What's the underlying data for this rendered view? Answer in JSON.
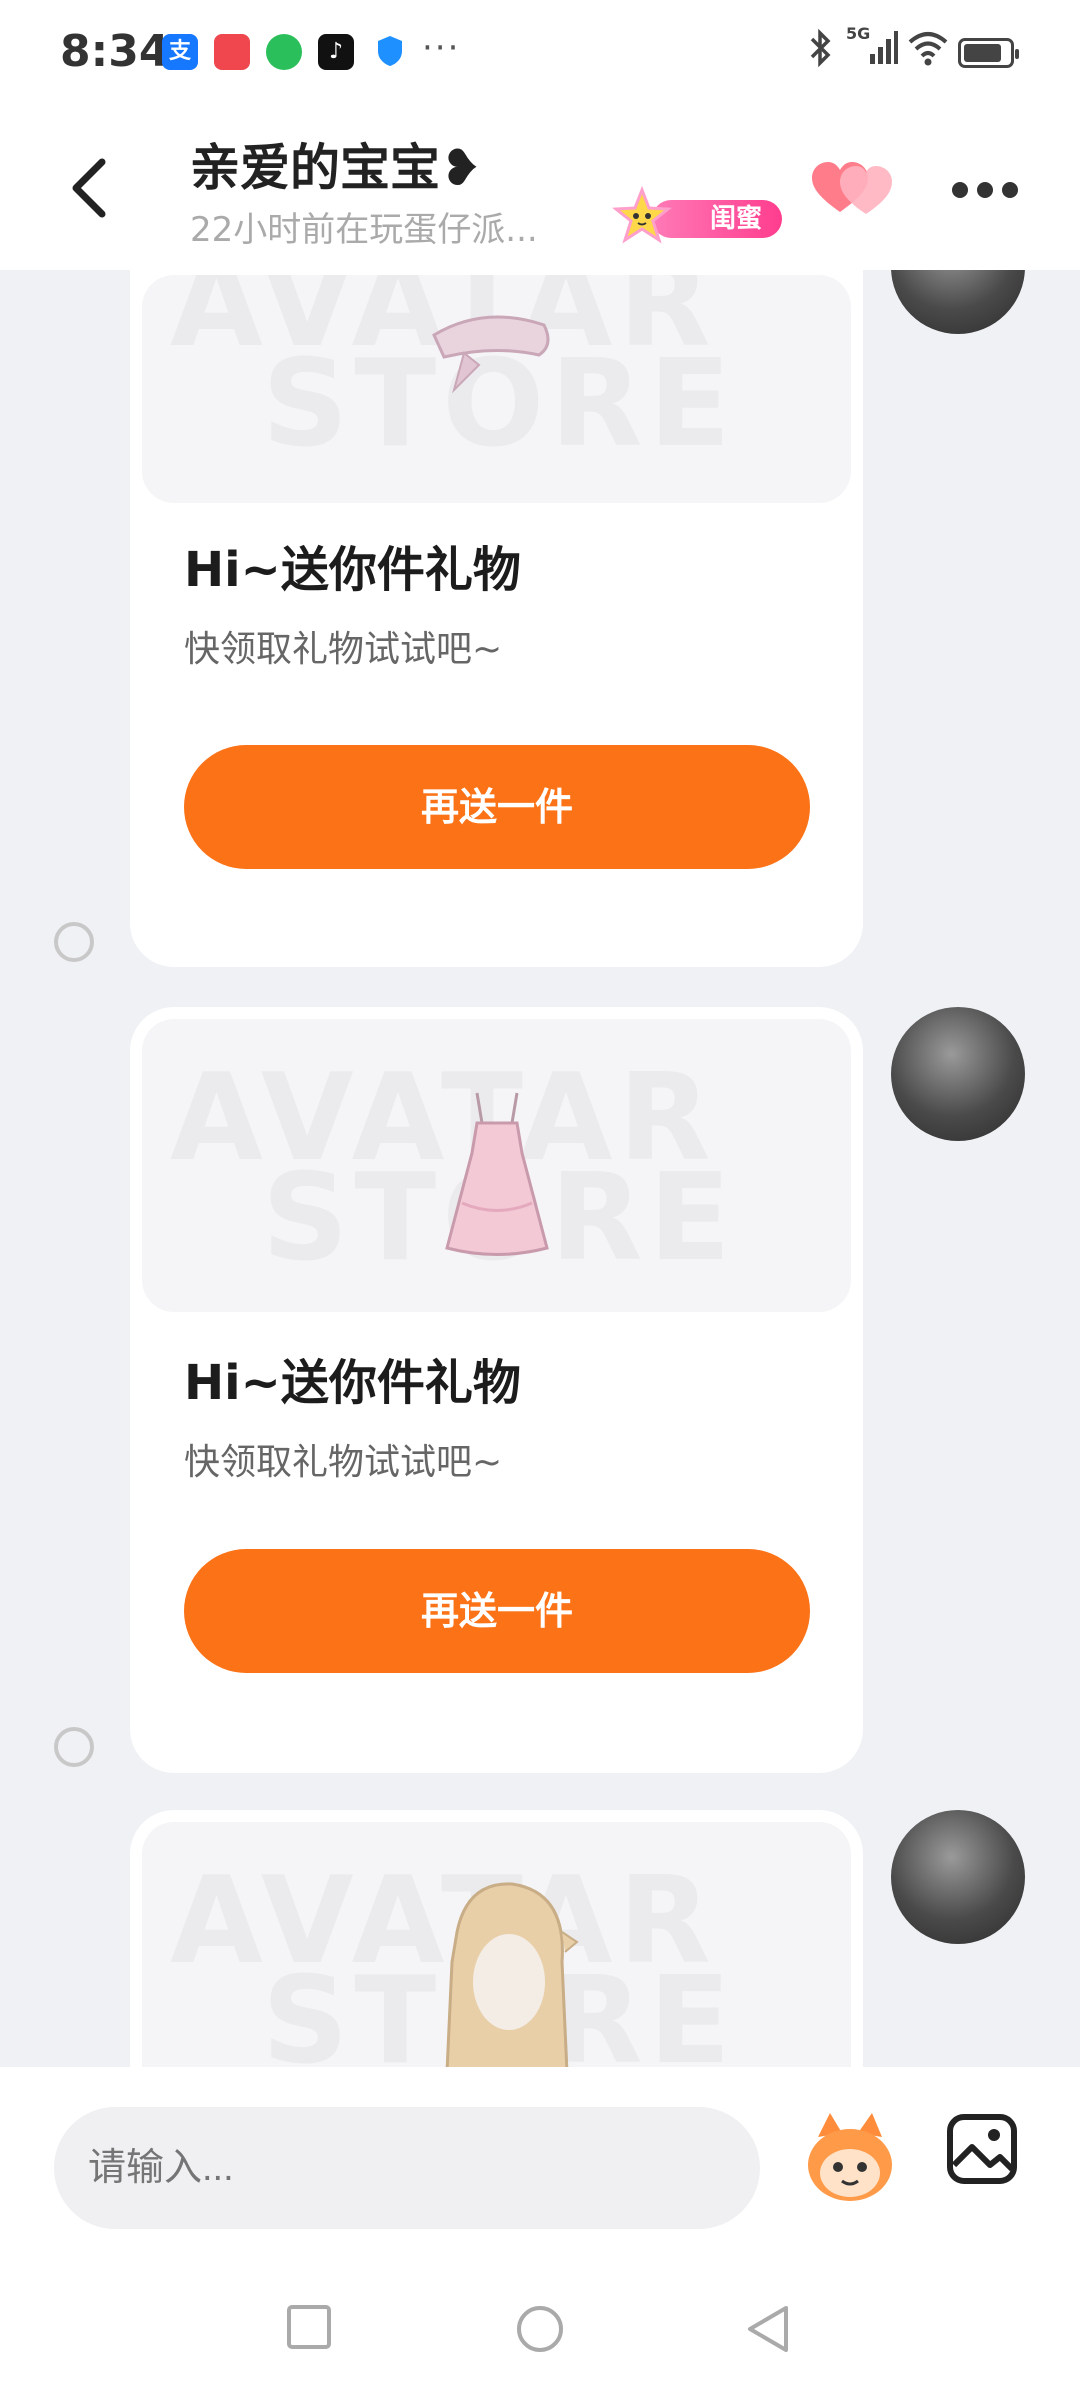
{
  "status_bar": {
    "time": "8:34",
    "app_icons": [
      {
        "name": "alipay-icon",
        "glyph": "支",
        "color": "#1677ff"
      },
      {
        "name": "shopping-icon",
        "glyph": "",
        "color": "#f0474f"
      },
      {
        "name": "wechat-icon",
        "glyph": "",
        "color": "#2bbf5c"
      },
      {
        "name": "tiktok-icon",
        "glyph": "♪",
        "color": "#111111"
      },
      {
        "name": "shield-icon",
        "glyph": "",
        "color": "#1e90ff"
      }
    ],
    "more_notifications": "···",
    "network": "5G",
    "battery_level": 0.85
  },
  "header": {
    "title": "亲爱的宝宝❥",
    "subtitle": "22小时前在玩蛋仔派...",
    "relation_badge": "闺蜜",
    "accent_color": "#fb7217"
  },
  "messages": [
    {
      "heading": "Hi~送你件礼物",
      "desc": "快领取礼物试试吧~",
      "button": "再送一件",
      "item": "hair-accessory"
    },
    {
      "heading": "Hi~送你件礼物",
      "desc": "快领取礼物试试吧~",
      "button": "再送一件",
      "item": "pink-dress"
    },
    {
      "item": "blonde-hair"
    }
  ],
  "watermark": {
    "line1": "AVATAR",
    "line2": "STORE"
  },
  "input": {
    "placeholder": "请输入..."
  }
}
